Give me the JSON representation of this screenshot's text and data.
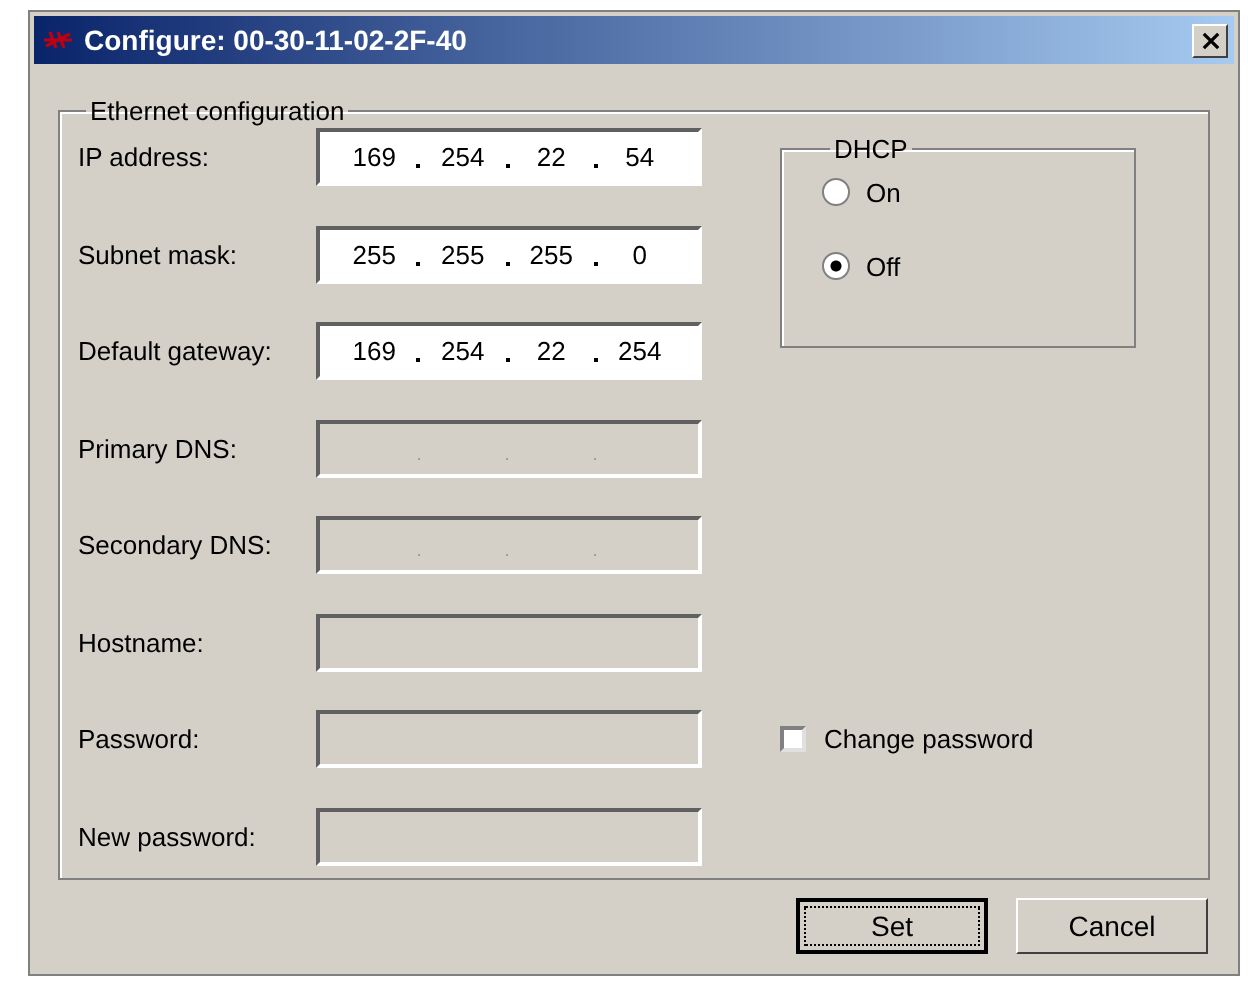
{
  "window": {
    "title": "Configure: 00-30-11-02-2F-40"
  },
  "ethernet": {
    "title": "Ethernet configuration",
    "fields": [
      {
        "label": "IP address:",
        "kind": "ip",
        "disabled": false,
        "octets": [
          "169",
          "254",
          "22",
          "54"
        ]
      },
      {
        "label": "Subnet mask:",
        "kind": "ip",
        "disabled": false,
        "octets": [
          "255",
          "255",
          "255",
          "0"
        ]
      },
      {
        "label": "Default gateway:",
        "kind": "ip",
        "disabled": false,
        "octets": [
          "169",
          "254",
          "22",
          "254"
        ]
      },
      {
        "label": "Primary DNS:",
        "kind": "ip",
        "disabled": true
      },
      {
        "label": "Secondary DNS:",
        "kind": "ip",
        "disabled": true
      },
      {
        "label": "Hostname:",
        "kind": "text",
        "disabled": true
      },
      {
        "label": "Password:",
        "kind": "text",
        "disabled": true
      },
      {
        "label": "New password:",
        "kind": "text",
        "disabled": true
      }
    ],
    "dhcp": {
      "title": "DHCP",
      "options": [
        {
          "label": "On",
          "selected": false
        },
        {
          "label": "Off",
          "selected": true
        }
      ]
    },
    "change_password": {
      "label": "Change password",
      "checked": false
    }
  },
  "buttons": [
    {
      "label": "Set",
      "focused": true
    },
    {
      "label": "Cancel",
      "focused": false
    }
  ]
}
